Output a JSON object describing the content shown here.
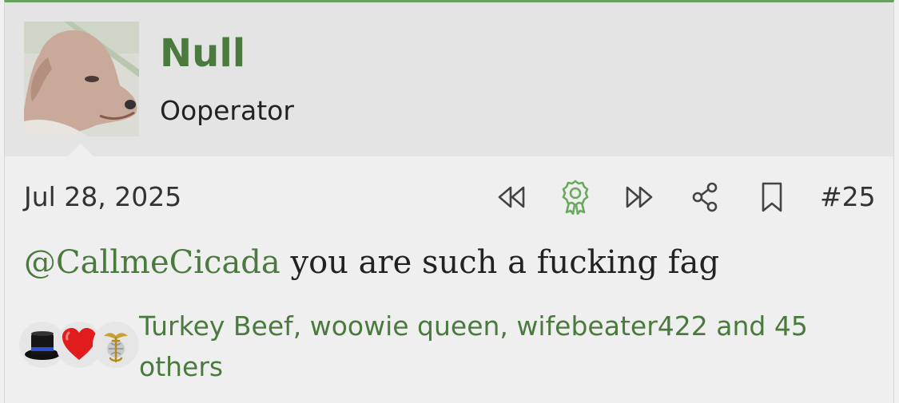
{
  "post": {
    "username": "Null",
    "user_title": "Ooperator",
    "date": "Jul 28, 2025",
    "post_number": "#25",
    "message": {
      "mention": "@CallmeCicada",
      "text": " you are such a fucking fag"
    },
    "actions": [
      {
        "icon": "rewind-icon",
        "label": "Previous"
      },
      {
        "icon": "award-ribbon-icon",
        "label": "Award"
      },
      {
        "icon": "fast-forward-icon",
        "label": "Next"
      },
      {
        "icon": "share-icon",
        "label": "Share"
      },
      {
        "icon": "bookmark-icon",
        "label": "Bookmark"
      }
    ],
    "reactions": {
      "icons": [
        "top-hat-icon",
        "heart-icon",
        "eagle-globe-anchor-icon"
      ],
      "summary": "Turkey Beef, woowie queen, wifebeater422 and 45 others"
    }
  },
  "colors": {
    "accent_green": "#4a7a3e",
    "top_border": "#6a9f62",
    "header_bg": "#e4e4e4",
    "body_bg": "#efefef"
  }
}
